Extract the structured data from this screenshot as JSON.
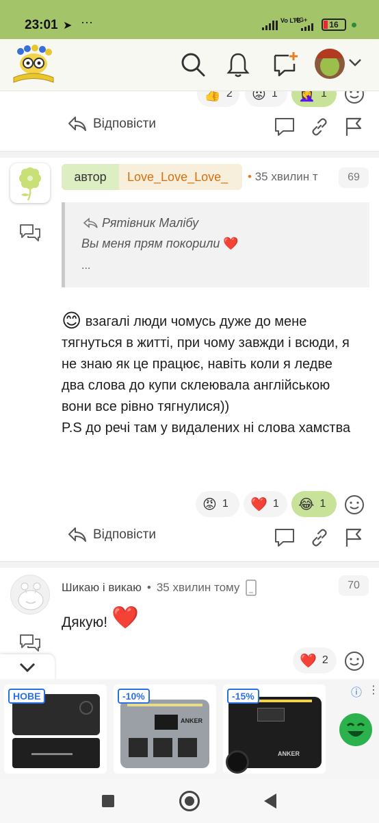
{
  "status": {
    "time": "23:01",
    "network": "4G+",
    "lte": "Vo LTE",
    "battery": "16"
  },
  "header": {
    "logo": "owl-book-logo",
    "search_icon": "search-icon",
    "bell_icon": "bell-icon",
    "new_post_icon": "chat-plus-icon",
    "avatar": "user-avatar",
    "chevron": "chevron-down-icon"
  },
  "top_reactions": [
    {
      "emoji": "👍",
      "count": "2"
    },
    {
      "emoji": "😡",
      "count": "1"
    },
    {
      "emoji": "🤦‍♀️",
      "count": "1"
    }
  ],
  "reply_label": "Відповісти",
  "comment1": {
    "author_label": "автор",
    "author_name": "Love_Love_Love_",
    "time": "35 хвилин т",
    "number": "69",
    "quote": {
      "name": "Рятівник Малібу",
      "text": "Вы меня прям покорили",
      "heart": "❤️",
      "more": "..."
    },
    "emoji": "😊",
    "text": "взагалі люди чомусь дуже до мене тягнуться в житті, при чому завжди і всюди, я не знаю як це працює, навіть коли я ледве два слова до купи склеювала англійською вони все рівно тягнулися))\nP.S до речі там у видалених ні слова хамства",
    "reactions": [
      {
        "emoji": "😡",
        "count": "1"
      },
      {
        "emoji": "❤️",
        "count": "1"
      },
      {
        "emoji": "😂",
        "count": "1"
      }
    ]
  },
  "comment2": {
    "author_name": "Шикаю і викаю",
    "time": "35 хвилин тому",
    "number": "70",
    "text": "Дякую!",
    "heart": "❤️",
    "reactions": [
      {
        "emoji": "❤️",
        "count": "2"
      }
    ]
  },
  "ad": {
    "products": [
      {
        "tag": "НОВЕ"
      },
      {
        "tag": "-10%"
      },
      {
        "tag": "-15%"
      }
    ],
    "brand": "ANKER",
    "info": "ⓘ",
    "more": "⋮"
  }
}
